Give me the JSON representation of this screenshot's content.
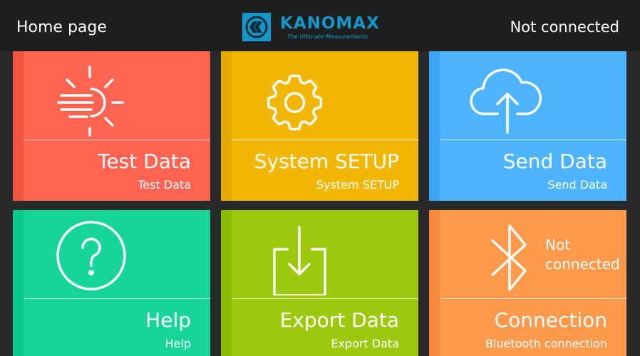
{
  "header": {
    "title": "Home page",
    "logo_text": "KANOMAX",
    "logo_tagline": "The Ultimate Measurements",
    "status": "Not connected"
  },
  "tiles": [
    {
      "title": "Test Data",
      "subtitle": "Test Data",
      "icon": "weather-sun-wind-icon",
      "color": "#ff6452",
      "bar_color": "#f25540"
    },
    {
      "title": "System SETUP",
      "subtitle": "System SETUP",
      "icon": "gear-icon",
      "color": "#f2b705",
      "bar_color": "#e5aa00"
    },
    {
      "title": "Send Data",
      "subtitle": "Send Data",
      "icon": "cloud-upload-icon",
      "color": "#4fb4ff",
      "bar_color": "#3aa6f5"
    },
    {
      "title": "Help",
      "subtitle": "Help",
      "icon": "question-circle-icon",
      "color": "#17d59a",
      "bar_color": "#0bc88c"
    },
    {
      "title": "Export Data",
      "subtitle": "Export Data",
      "icon": "download-tray-icon",
      "color": "#9cc90d",
      "bar_color": "#8dbb00"
    },
    {
      "title": "Connection",
      "subtitle": "Bluetooth connection",
      "icon": "bluetooth-icon",
      "color": "#ff9a4d",
      "bar_color": "#f58b3a",
      "status_line1": "Not",
      "status_line2": "connected"
    }
  ]
}
